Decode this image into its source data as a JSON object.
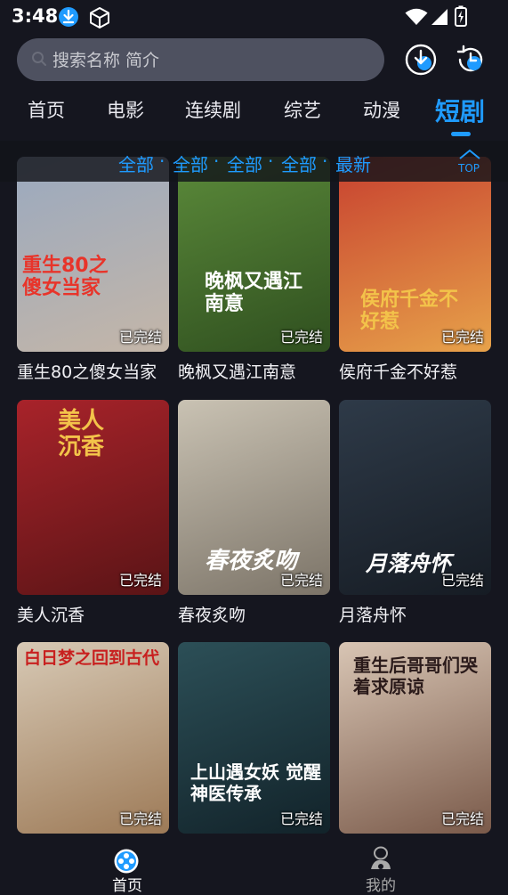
{
  "status_bar": {
    "time": "3:48",
    "icons": [
      "download-notification-icon",
      "cube-app-icon",
      "wifi-icon",
      "signal-icon",
      "battery-charging-icon"
    ]
  },
  "header": {
    "search_placeholder": "搜索名称 简介",
    "download_icon": "download-icon",
    "history_icon": "history-icon"
  },
  "tabs": [
    {
      "label": "首页",
      "active": false
    },
    {
      "label": "电影",
      "active": false
    },
    {
      "label": "连续剧",
      "active": false
    },
    {
      "label": "综艺",
      "active": false
    },
    {
      "label": "动漫",
      "active": false
    },
    {
      "label": "短剧",
      "active": true
    }
  ],
  "filters": {
    "items": [
      "全部",
      "全部",
      "全部",
      "全部",
      "最新"
    ],
    "separator": "·"
  },
  "top_button": {
    "label": "TOP"
  },
  "dramas": [
    {
      "title": "重生80之傻女当家",
      "status": "已完结",
      "poster_text": "重生80之傻女当家",
      "colors": [
        "#9aa9bf",
        "#c4b6a8"
      ]
    },
    {
      "title": "晚枫又遇江南意",
      "status": "已完结",
      "poster_text": "晚枫又遇江南意",
      "colors": [
        "#5b8a3a",
        "#2f4f1f"
      ]
    },
    {
      "title": "侯府千金不好惹",
      "status": "已完结",
      "poster_text": "侯府千金不好惹",
      "colors": [
        "#c7402f",
        "#e7a24a"
      ]
    },
    {
      "title": "美人沉香",
      "status": "已完结",
      "poster_text": "美人沉香",
      "colors": [
        "#a8232a",
        "#5a1416"
      ]
    },
    {
      "title": "春夜炙吻",
      "status": "已完结",
      "poster_text": "春夜炙吻",
      "colors": [
        "#c9c2b3",
        "#7c7468"
      ]
    },
    {
      "title": "月落舟怀",
      "status": "已完结",
      "poster_text": "月落舟怀",
      "colors": [
        "#2e3a48",
        "#161c24"
      ]
    },
    {
      "title": "",
      "status": "已完结",
      "poster_text": "白日梦之回到古代",
      "colors": [
        "#d7c9b5",
        "#9d7a57"
      ]
    },
    {
      "title": "",
      "status": "已完结",
      "poster_text": "上山遇女妖 觉醒神医传承",
      "colors": [
        "#2c4f57",
        "#12232a"
      ]
    },
    {
      "title": "",
      "status": "已完结",
      "poster_text": "重生后哥哥们哭着求原谅",
      "colors": [
        "#d8c5b4",
        "#7a5a4a"
      ]
    }
  ],
  "bottom_nav": [
    {
      "label": "首页",
      "icon": "home-grid-icon",
      "active": true
    },
    {
      "label": "我的",
      "icon": "profile-icon",
      "active": false
    }
  ],
  "colors": {
    "accent": "#1f9bff",
    "background": "#15161f",
    "search_bg": "#4e5160"
  }
}
